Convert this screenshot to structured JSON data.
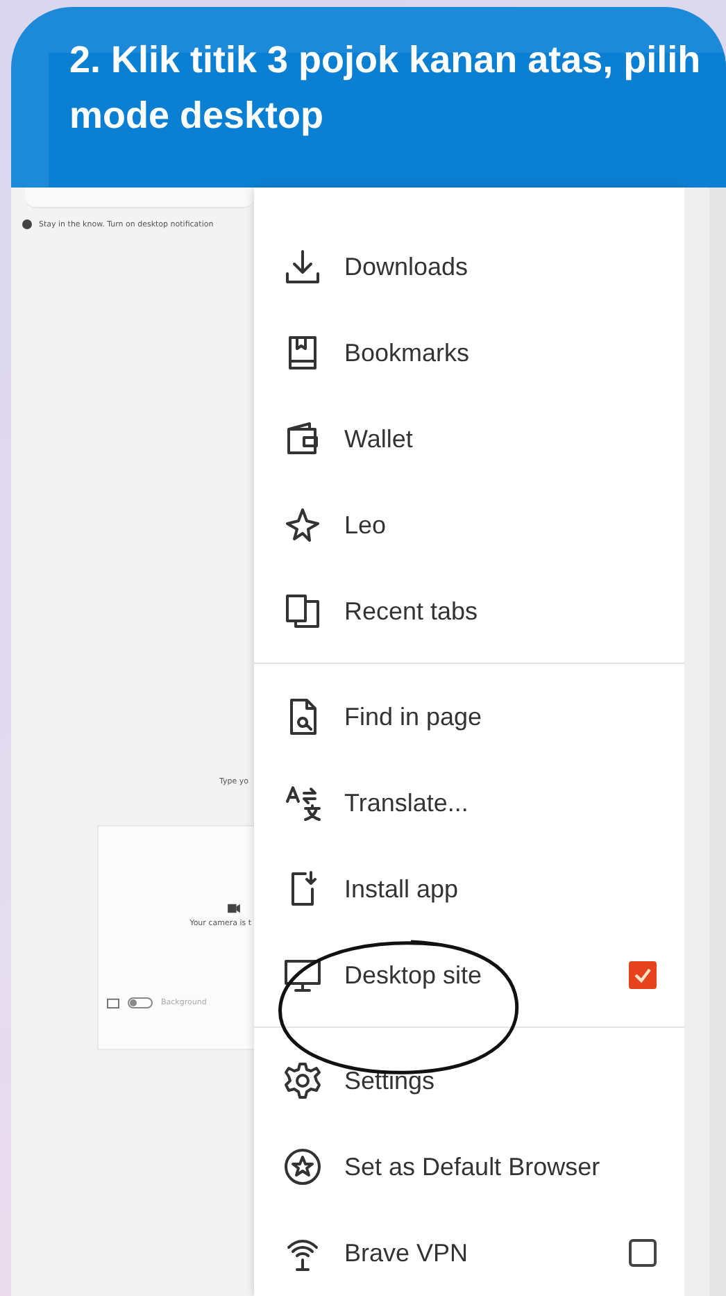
{
  "heading": "2. Klik titik 3 pojok kanan atas, pilih mode desktop",
  "background_page": {
    "notification": "Stay in the know. Turn on desktop notification",
    "prompt": "Type yo",
    "camera_message": "Your camera is t",
    "background_label": "Background",
    "background_toggle": {
      "on": false
    }
  },
  "menu": {
    "items": [
      {
        "kind": "item",
        "label": "Downloads"
      },
      {
        "kind": "item",
        "label": "Bookmarks"
      },
      {
        "kind": "item",
        "label": "Wallet"
      },
      {
        "kind": "item",
        "label": "Leo"
      },
      {
        "kind": "item",
        "label": "Recent tabs"
      },
      {
        "kind": "divider"
      },
      {
        "kind": "item",
        "label": "Find in page"
      },
      {
        "kind": "item",
        "label": "Translate..."
      },
      {
        "kind": "item",
        "label": "Install app"
      },
      {
        "kind": "check",
        "label": "Desktop site",
        "checked": true
      },
      {
        "kind": "divider"
      },
      {
        "kind": "item",
        "label": "Settings"
      },
      {
        "kind": "item",
        "label": "Set as Default Browser"
      },
      {
        "kind": "check",
        "label": "Brave VPN",
        "checked": false
      }
    ]
  }
}
